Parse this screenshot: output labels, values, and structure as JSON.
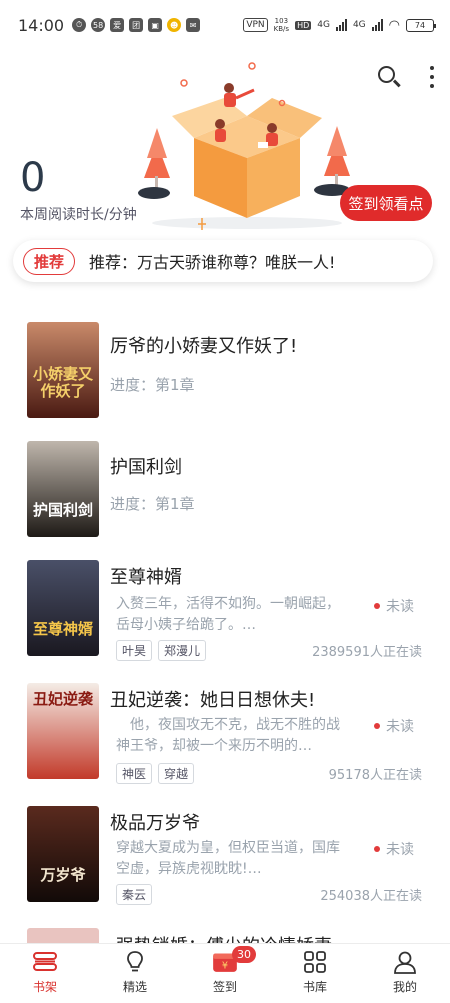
{
  "status_bar": {
    "time": "14:00",
    "app_badges": [
      "58",
      "爱",
      "团"
    ],
    "vpn": "VPN",
    "net_speed": "103",
    "net_unit": "KB/s",
    "hd": "HD",
    "signal1": "4G",
    "signal2": "4G",
    "battery": "74"
  },
  "header": {
    "weekly_read_minutes": "0",
    "weekly_read_label": "本周阅读时长/分钟",
    "signin_button": "签到领看点"
  },
  "recommend": {
    "badge": "推荐",
    "text": "推荐：万古天骄谁称尊？唯朕一人!"
  },
  "books": [
    {
      "title": "厉爷的小娇妻又作妖了!",
      "progress": "进度：第1章",
      "cover_text": "小娇妻又作妖了",
      "cover_color": "#6b2b1e"
    },
    {
      "title": "护国利剑",
      "progress": "进度：第1章",
      "cover_text": "护国利剑",
      "cover_color": "#2a2622"
    },
    {
      "title": "至尊神婿",
      "desc": "入赘三年，活得不如狗。一朝崛起，岳母小姨子给跪了。…",
      "status": "未读",
      "tags": [
        "叶昊",
        "郑漫儿"
      ],
      "readers": "2389591人正在读",
      "cover_text": "至尊神婿",
      "cover_color": "#3b3a4a"
    },
    {
      "title": "丑妃逆袭：她日日想休夫!",
      "desc": "他，夜国攻无不克，战无不胜的战神王爷，却被一个来历不明的…",
      "status": "未读",
      "tags": [
        "神医",
        "穿越"
      ],
      "readers": "95178人正在读",
      "cover_text": "丑妃逆袭",
      "cover_color": "#f3ebe6"
    },
    {
      "title": "极品万岁爷",
      "desc": "穿越大夏成为皇，但权臣当道，国库空虚，异族虎视眈眈!…",
      "status": "未读",
      "tags": [
        "秦云"
      ],
      "readers": "254038人正在读",
      "cover_text": "万岁爷",
      "cover_color": "#2a1a16"
    }
  ],
  "partial_book_title": "强势锁婚：傅少的冷情娇妻",
  "bottom_nav": {
    "items": [
      {
        "label": "书架",
        "icon": "bookshelf-icon",
        "active": true
      },
      {
        "label": "精选",
        "icon": "lightbulb-icon",
        "active": false
      },
      {
        "label": "签到",
        "icon": "gift-icon",
        "active": false
      },
      {
        "label": "书库",
        "icon": "grid-icon",
        "active": false
      },
      {
        "label": "我的",
        "icon": "person-icon",
        "active": false
      }
    ],
    "signin_badge": "30"
  },
  "colors": {
    "accent": "#e02b2b",
    "muted": "#9aa3ad"
  }
}
